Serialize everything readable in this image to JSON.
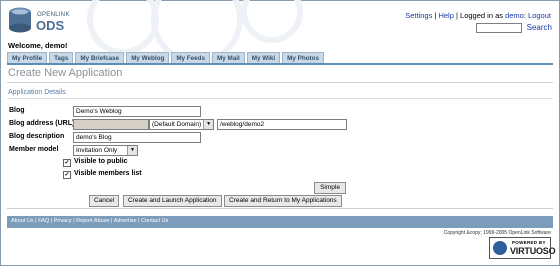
{
  "header": {
    "logo_small": "OPENLINK",
    "logo_main": "ODS",
    "links": [
      {
        "label": "Settings"
      },
      {
        "label": "Help"
      }
    ],
    "logged_in_text": "Logged in as",
    "user": "demo",
    "logout": "Logout",
    "search_label": "Search",
    "search_value": ""
  },
  "welcome": "Welcome, demo!",
  "tabs": [
    "My Profile",
    "Tags",
    "My Briefcase",
    "My Weblog",
    "My Feeds",
    "My Mail",
    "My Wiki",
    "My Photos"
  ],
  "page_title": "Create New Application",
  "section_title": "Application Details",
  "form": {
    "blog_label": "Blog",
    "blog_value": "Demo's Weblog",
    "address_label": "Blog address (URL)",
    "address_host": "",
    "address_domain": "(Default Domain)",
    "address_path": "/weblog/demo2",
    "description_label": "Blog description",
    "description_value": "demo's Blog",
    "member_model_label": "Member model",
    "member_model_value": "Invitation Only",
    "visible_public": "Visible to public",
    "visible_members": "Visible members list"
  },
  "buttons": {
    "simple": "Simple",
    "cancel": "Cancel",
    "create_launch": "Create and Launch Application",
    "create_return": "Create and Return to My Applications"
  },
  "footer": {
    "links": [
      "About Us",
      "FAQ",
      "Privacy",
      "Report Abuse",
      "Advertise",
      "Contact Us"
    ],
    "copyright": "Copyright &copy; 1999-2005 OpenLink Software",
    "powered": "POWERED BY",
    "product": "VIRTUOSO"
  }
}
